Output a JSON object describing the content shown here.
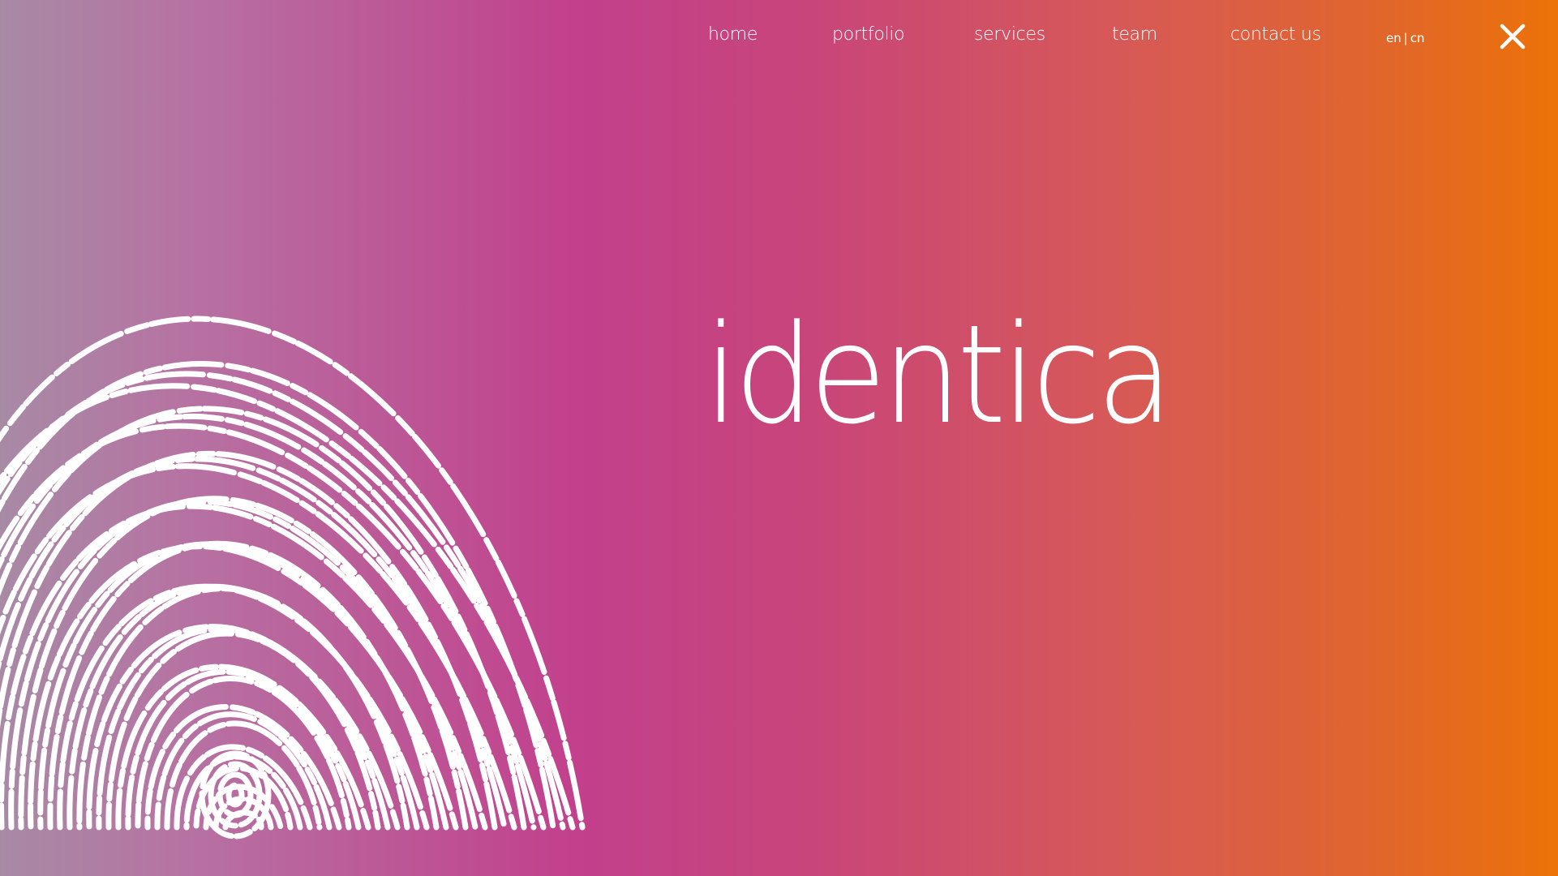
{
  "nav": {
    "items": [
      "home",
      "portfolio",
      "services",
      "team",
      "contact us"
    ],
    "lang": {
      "en": "en",
      "separator": "|",
      "cn": "cn"
    }
  },
  "hero": {
    "title": "identica"
  },
  "icons": {
    "close": "close-icon",
    "fingerprint": "fingerprint-icon"
  },
  "colors": {
    "gradient_start": "#a88aa5",
    "gradient_mid": "#c2408c",
    "gradient_end": "#ec7209",
    "text": "#ffffff"
  }
}
